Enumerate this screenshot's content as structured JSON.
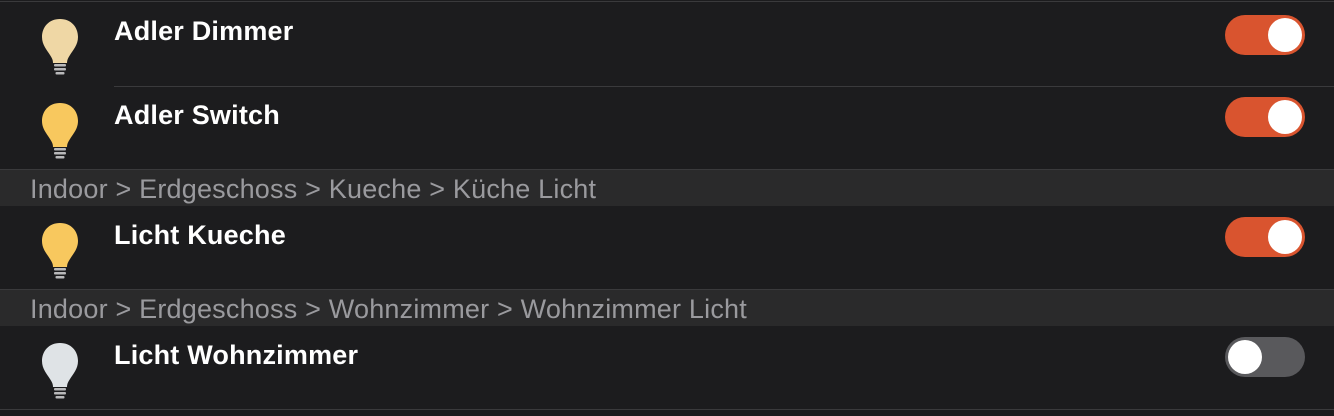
{
  "groups": [
    {
      "header": "",
      "items": [
        {
          "name": "Adler Dimmer",
          "on": true,
          "icon": "lightbulb-icon",
          "bulb_color": "#efd7a5"
        },
        {
          "name": "Adler Switch",
          "on": true,
          "icon": "lightbulb-icon",
          "bulb_color": "#f8c85e"
        }
      ]
    },
    {
      "header": "Indoor > Erdgeschoss > Kueche > Küche Licht",
      "items": [
        {
          "name": "Licht Kueche",
          "on": true,
          "icon": "lightbulb-icon",
          "bulb_color": "#f8c85e"
        }
      ]
    },
    {
      "header": "Indoor > Erdgeschoss > Wohnzimmer > Wohnzimmer Licht",
      "items": [
        {
          "name": "Licht Wohnzimmer",
          "on": false,
          "icon": "lightbulb-icon",
          "bulb_color": "#dfe3e6"
        }
      ]
    }
  ],
  "colors": {
    "toggle_on": "#d9542f",
    "toggle_off": "#59595c",
    "background": "#1c1c1e",
    "header_background": "#2a2a2b"
  }
}
